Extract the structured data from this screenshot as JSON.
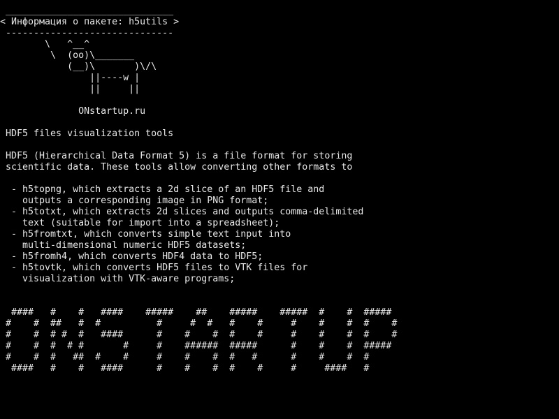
{
  "terminal": {
    "text_color": "#e8e8e8",
    "background": "#000000",
    "cowsay": {
      "top_border": " ______________________________",
      "message": "< Информация о пакете: h5utils >",
      "bottom_border": " ------------------------------",
      "cow_line1": "        \\   ^__^",
      "cow_line2": "         \\  (oo)\\_______",
      "cow_line3": "            (__)\\       )\\/\\",
      "cow_line4": "                ||----w |",
      "cow_line5": "                ||     ||",
      "blank1": "",
      "signature": "              ONstartup.ru"
    },
    "description": {
      "blank_a": "",
      "summary": " HDF5 files visualization tools",
      "blank_b": "",
      "para1": " HDF5 (Hierarchical Data Format 5) is a file format for storing",
      "para2": " scientific data. These tools allow converting other formats to",
      "blank_c": "",
      "item1a": "  - h5topng, which extracts a 2d slice of an HDF5 file and",
      "item1b": "    outputs a corresponding image in PNG format;",
      "item2a": "  - h5totxt, which extracts 2d slices and outputs comma-delimited",
      "item2b": "    text (suitable for import into a spreadsheet);",
      "item3a": "  - h5fromtxt, which converts simple text input into",
      "item3b": "    multi-dimensional numeric HDF5 datasets;",
      "item4": "  - h5fromh4, which converts HDF4 data to HDF5;",
      "item5a": "  - h5tovtk, which converts HDF5 files to VTK files for",
      "item5b": "    visualization with VTK-aware programs;"
    },
    "banner": {
      "blank_d": "",
      "blank_e": "",
      "row1": "  ####   #    #   ####    #####    ##    #####    #####  #    #  #####",
      "row2": " #    #  ##   #  #          #     #  #   #    #     #    #    #  #    #",
      "row3": " #    #  # #  #   ####      #    #    #  #    #     #    #    #  #    #",
      "row4": " #    #  #  # #       #     #    ######  #####      #    #    #  #####",
      "row5": " #    #  #   ##  #    #     #    #    #  #   #      #    #    #  #",
      "row6": "  ####   #    #   ####      #    #    #  #    #     #     ####   #"
    }
  }
}
